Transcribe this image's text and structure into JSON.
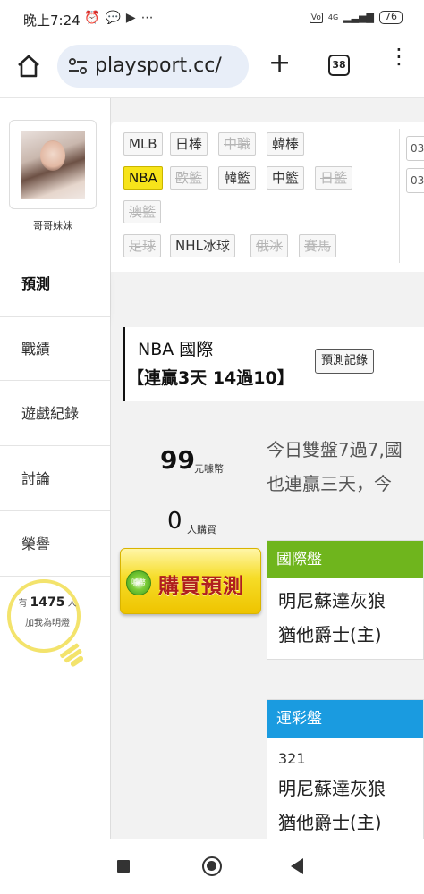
{
  "status_bar": {
    "time": "晚上7:24",
    "icons": [
      "alarm-icon",
      "chat-icon",
      "youtube-icon",
      "more-icon"
    ],
    "network": "4G",
    "battery": "76"
  },
  "browser": {
    "url": "playsport.cc/",
    "tab_count": "38"
  },
  "sidebar": {
    "nickname": "哥哥妹妹",
    "items": [
      {
        "label": "預測",
        "active": true
      },
      {
        "label": "戰績"
      },
      {
        "label": "遊戲紀錄"
      },
      {
        "label": "討論"
      },
      {
        "label": "榮譽"
      }
    ],
    "fans": {
      "prefix": "有",
      "count": "1475",
      "suffix": "人",
      "subtitle": "加我為明燈"
    }
  },
  "filter": {
    "rows": [
      [
        {
          "label": "MLB",
          "state": "on"
        },
        {
          "label": "日棒",
          "state": "on"
        },
        {
          "label": "中職",
          "state": "off"
        },
        {
          "label": "韓棒",
          "state": "on"
        }
      ],
      [
        {
          "label": "NBA",
          "state": "active"
        },
        {
          "label": "歐籃",
          "state": "off"
        },
        {
          "label": "韓籃",
          "state": "on"
        },
        {
          "label": "中籃",
          "state": "on"
        },
        {
          "label": "日籃",
          "state": "off"
        }
      ],
      [
        {
          "label": "澳籃",
          "state": "off"
        }
      ],
      [
        {
          "label": "足球",
          "state": "off"
        },
        {
          "label": "NHL冰球",
          "state": "on"
        },
        {
          "label": "俄冰",
          "state": "off"
        },
        {
          "label": "賽馬",
          "state": "off"
        }
      ]
    ],
    "date_cut": [
      "03",
      "03"
    ]
  },
  "record": {
    "league": "NBA 國際",
    "streak": "【連贏3天 14過10】",
    "history_button": "預測記錄"
  },
  "price": {
    "amount": "99",
    "unit": "元噱幣",
    "buyers": "0",
    "buyers_unit": "人購買"
  },
  "buy_button": {
    "logo_text": "噱幣",
    "label": "購買預測"
  },
  "analysis": {
    "line1": "今日雙盤7過7,國",
    "line2": "也連贏三天，今"
  },
  "panels": {
    "international": {
      "title": "國際盤",
      "team1": "明尼蘇達灰狼",
      "team2": "猶他爵士(主)"
    },
    "lottery": {
      "title": "運彩盤",
      "code": "321",
      "team1": "明尼蘇達灰狼",
      "team2": "猶他爵士(主)"
    }
  },
  "colors": {
    "active_chip": "#f7e41a",
    "intl_header": "#6fb51d",
    "lottery_header": "#1a9be0",
    "buy_button": "#f6dc27",
    "bulb_ring": "#f3e36c"
  }
}
